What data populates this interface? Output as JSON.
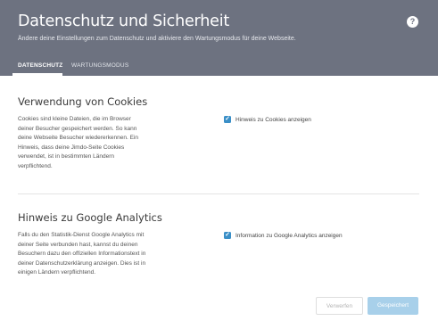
{
  "header": {
    "title": "Datenschutz und Sicherheit",
    "subtitle": "Ändere deine Einstellungen zum Datenschutz und aktiviere den Wartungsmodus für deine Webseite.",
    "help_icon": "?"
  },
  "tabs": [
    {
      "label": "DATENSCHUTZ",
      "active": true
    },
    {
      "label": "WARTUNGSMODUS",
      "active": false
    }
  ],
  "sections": [
    {
      "title": "Verwendung von Cookies",
      "description": "Cookies sind kleine Dateien, die im Browser deiner Besucher gespeichert werden. So kann deine Webseite Besucher wiedererkennen. Ein Hinweis, dass deine Jimdo-Seite Cookies verwendet, ist in bestimmten Ländern verpflichtend.",
      "checkbox_label": "Hinweis zu Cookies anzeigen",
      "checked": true
    },
    {
      "title": "Hinweis zu Google Analytics",
      "description": "Falls du den Statistik-Dienst Google Analytics mit deiner Seite verbunden hast, kannst du deinen Besuchern dazu den offiziellen Informationstext in deiner Datenschutzerklärung anzeigen. Dies ist in einigen Ländern verpflichtend.",
      "checkbox_label": "Information zu Google Analytics anzeigen",
      "checked": true
    }
  ],
  "footer": {
    "discard_label": "Verwerfen",
    "save_label": "Gespeichert"
  },
  "colors": {
    "header_bg": "#6d7280",
    "checkbox": "#3a8fc7",
    "save_button": "#a8d0ea"
  },
  "icons": {
    "help": "question-circle-icon",
    "check": "checkmark-icon"
  }
}
